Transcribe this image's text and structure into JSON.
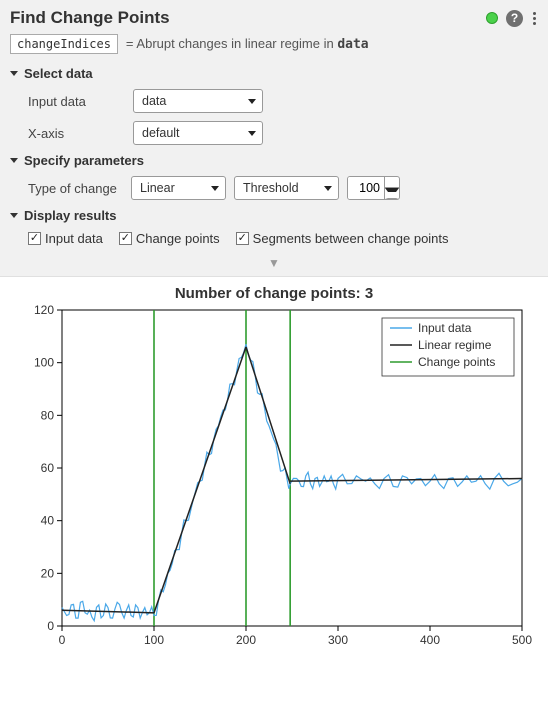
{
  "header": {
    "title": "Find Change Points",
    "output_var": "changeIndices",
    "equals": "=",
    "description_pre": "Abrupt changes in linear regime in ",
    "description_kw": "data"
  },
  "sections": {
    "select_data": {
      "label": "Select data",
      "fields": {
        "input_data": {
          "label": "Input data",
          "value": "data"
        },
        "x_axis": {
          "label": "X-axis",
          "value": "default"
        }
      }
    },
    "specify_params": {
      "label": "Specify parameters",
      "fields": {
        "type_of_change": {
          "label": "Type of change",
          "value": "Linear"
        },
        "detection": {
          "value": "Threshold"
        },
        "threshold_value": "100"
      }
    },
    "display_results": {
      "label": "Display results",
      "checks": {
        "input_data": "Input data",
        "change_points": "Change points",
        "segments": "Segments between change points"
      }
    }
  },
  "chart_data": {
    "type": "line",
    "title": "Number of change points: 3",
    "xlabel": "",
    "ylabel": "",
    "xlim": [
      0,
      500
    ],
    "ylim": [
      0,
      120
    ],
    "xticks": [
      0,
      100,
      200,
      300,
      400,
      500
    ],
    "yticks": [
      0,
      20,
      40,
      60,
      80,
      100,
      120
    ],
    "legend": [
      "Input data",
      "Linear regime",
      "Change points"
    ],
    "legend_position": "upper right",
    "change_points_x": [
      100,
      200,
      248
    ],
    "series": [
      {
        "name": "Input data",
        "color": "#4aa8e8",
        "x": [
          0,
          5,
          10,
          15,
          20,
          25,
          30,
          35,
          40,
          45,
          50,
          55,
          60,
          65,
          70,
          75,
          80,
          85,
          90,
          95,
          100,
          105,
          110,
          115,
          120,
          125,
          130,
          135,
          140,
          145,
          150,
          155,
          160,
          165,
          170,
          175,
          180,
          185,
          190,
          195,
          200,
          205,
          210,
          215,
          220,
          225,
          230,
          235,
          240,
          245,
          248,
          255,
          260,
          265,
          270,
          275,
          280,
          285,
          290,
          295,
          300,
          310,
          320,
          330,
          340,
          350,
          360,
          370,
          380,
          390,
          400,
          410,
          420,
          430,
          440,
          450,
          460,
          470,
          480,
          490,
          500
        ],
        "y": [
          7,
          4,
          8,
          3,
          9,
          5,
          6,
          2,
          8,
          4,
          7,
          3,
          9,
          5,
          6,
          4,
          8,
          3,
          7,
          5,
          4,
          10,
          13,
          20,
          24,
          29,
          35,
          40,
          44,
          51,
          55,
          61,
          65,
          71,
          76,
          82,
          86,
          92,
          97,
          102,
          107,
          101,
          95,
          88,
          83,
          76,
          71,
          64,
          59,
          55,
          54,
          56,
          53,
          57,
          54,
          56,
          53,
          57,
          55,
          54,
          56,
          54,
          57,
          55,
          54,
          56,
          53,
          57,
          54,
          56,
          55,
          54,
          56,
          53,
          57,
          55,
          54,
          56,
          55,
          54,
          56
        ]
      },
      {
        "name": "Linear regime",
        "color": "#222222",
        "segments": [
          {
            "x1": 0,
            "y1": 6,
            "x2": 100,
            "y2": 5
          },
          {
            "x1": 100,
            "y1": 5,
            "x2": 200,
            "y2": 106
          },
          {
            "x1": 200,
            "y1": 106,
            "x2": 248,
            "y2": 54
          },
          {
            "x1": 248,
            "y1": 55,
            "x2": 500,
            "y2": 56
          }
        ]
      }
    ]
  }
}
